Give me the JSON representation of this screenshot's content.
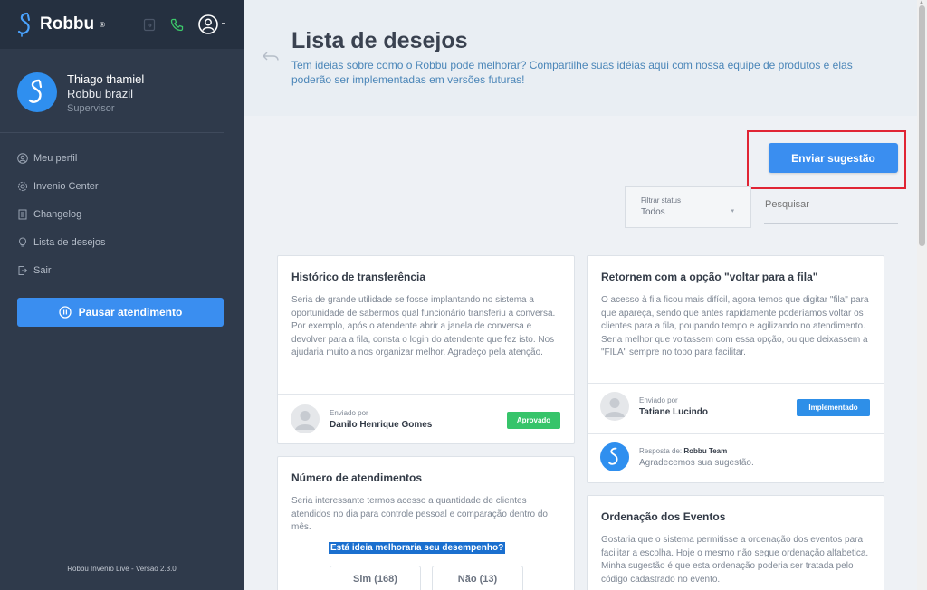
{
  "app": {
    "brand": "Robbu",
    "brand_mark": "®"
  },
  "user": {
    "name": "Thiago thamiel",
    "company": "Robbu brazil",
    "role": "Supervisor"
  },
  "nav": [
    {
      "label": "Meu perfil",
      "icon": "user-icon"
    },
    {
      "label": "Invenio Center",
      "icon": "gear-icon"
    },
    {
      "label": "Changelog",
      "icon": "document-icon"
    },
    {
      "label": "Lista de desejos",
      "icon": "lightbulb-icon"
    },
    {
      "label": "Sair",
      "icon": "logout-icon"
    }
  ],
  "pause_button": "Pausar atendimento",
  "version": "Robbu Invenio Live - Versão 2.3.0",
  "page": {
    "title": "Lista de desejos",
    "subtitle": "Tem ideias sobre como o Robbu pode melhorar? Compartilhe suas idéias aqui com nossa equipe de produtos e elas poderão ser implementadas em versões futuras!"
  },
  "send_button": "Enviar sugestão",
  "filter": {
    "label": "Filtrar status",
    "value": "Todos"
  },
  "search": {
    "placeholder": "Pesquisar"
  },
  "cards": [
    {
      "title": "Histórico de transferência",
      "text": "Seria de grande utilidade se fosse implantando no sistema a oportunidade de sabermos qual funcionário transferiu a conversa. Por exemplo, após o atendente abrir a janela de conversa e devolver para a fila, consta o login do atendente que fez isto. Nos ajudaria muito a nos organizar melhor. Agradeço pela atenção.",
      "sent_by_label": "Enviado por",
      "sender": "Danilo Henrique Gomes",
      "status": "Aprovado",
      "status_color": "#36c46a"
    },
    {
      "title": "Número de atendimentos",
      "text": "Seria interessante termos acesso a quantidade de clientes atendidos no dia para controle pessoal e comparação dentro do mês.",
      "poll_question": "Está ideia melhoraria seu desempenho?",
      "yes": "Sim (168)",
      "no": "Não (13)"
    },
    {
      "title": "Retornem com a opção \"voltar para a fila\"",
      "text": "O acesso à fila ficou mais difícil, agora temos que digitar \"fila\" para que apareça, sendo que antes rapidamente poderíamos voltar os clientes para a fila, poupando tempo e agilizando no atendimento. Seria melhor que voltassem com essa opção, ou que deixassem a \"FILA\" sempre no topo para facilitar.",
      "sent_by_label": "Enviado por",
      "sender": "Tatiane Lucindo",
      "status": "Implementado",
      "status_color": "#2e8fe8",
      "reply_label": "Resposta de:",
      "reply_from": "Robbu Team",
      "reply_text": "Agradecemos sua sugestão."
    },
    {
      "title": "Ordenação dos Eventos",
      "text": "Gostaria que o sistema permitisse a ordenação dos eventos para facilitar a escolha. Hoje o mesmo não segue ordenação alfabetica. Minha sugestão é que esta ordenação poderia ser tratada pelo código cadastrado no evento."
    }
  ],
  "colors": {
    "sidebar": "#2f3a4b",
    "accent": "#3a8ef0",
    "highlight": "#e02434"
  }
}
